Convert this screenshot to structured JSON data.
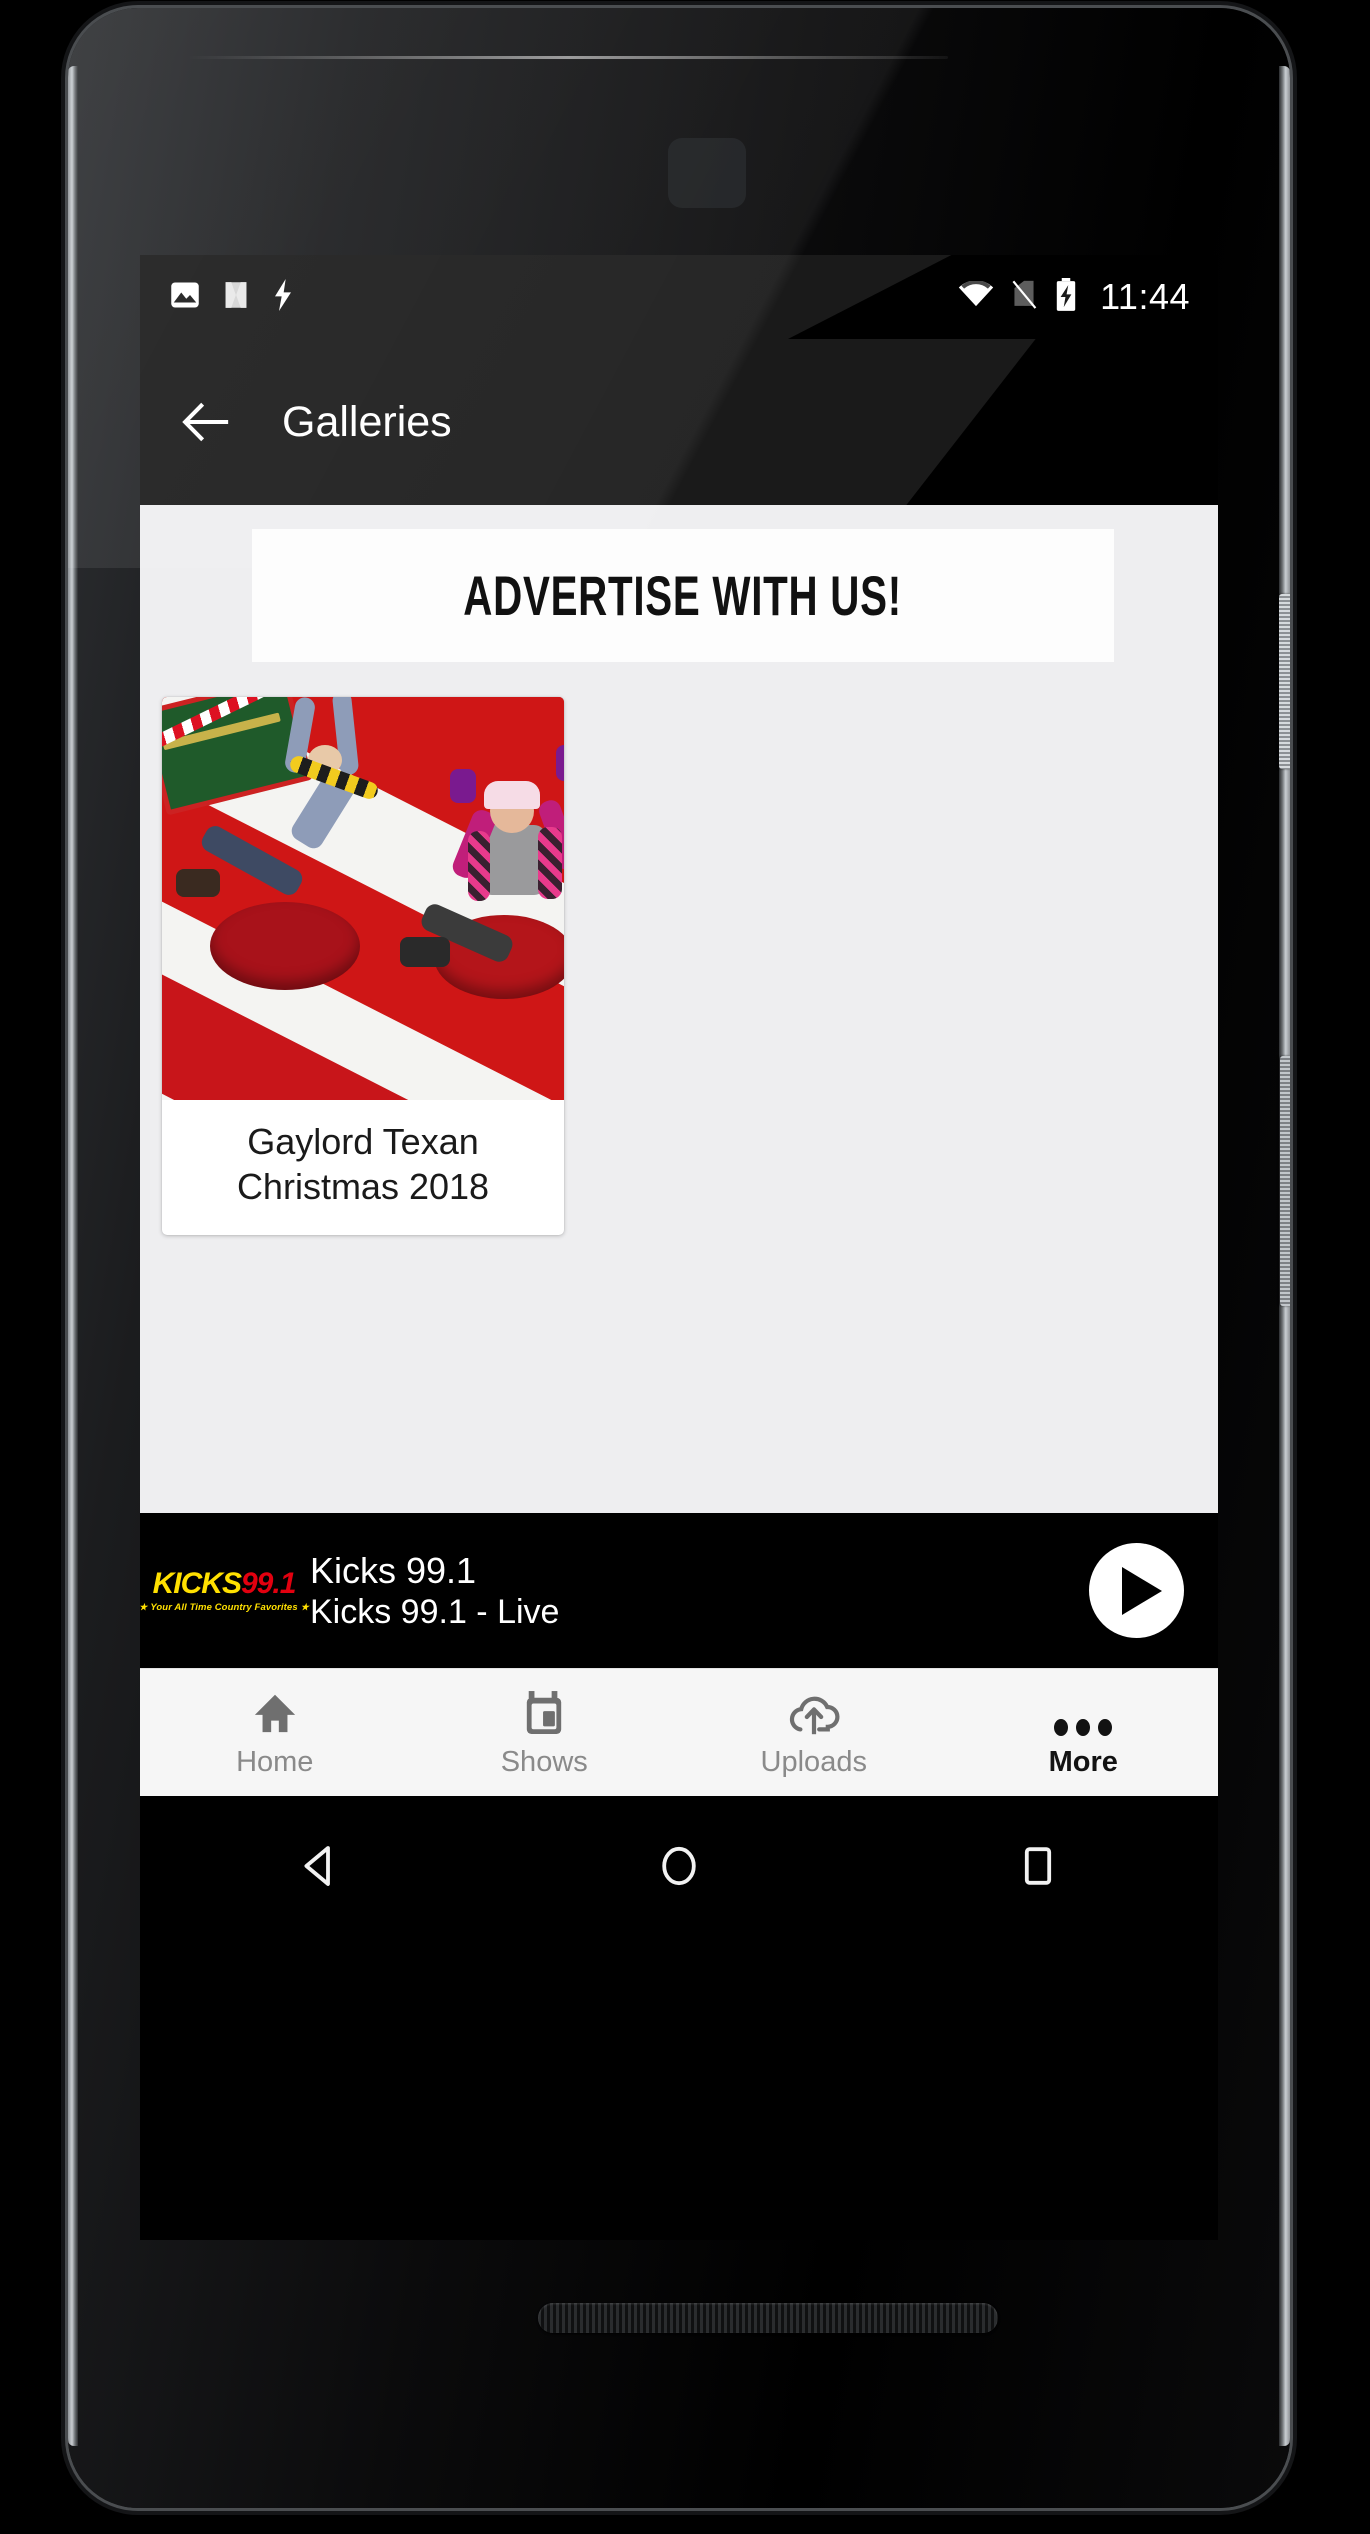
{
  "status_bar": {
    "time": "11:44",
    "left_icons": [
      {
        "name": "photo-icon",
        "glyph": "image"
      },
      {
        "name": "android-nougat-icon",
        "glyph": "N"
      },
      {
        "name": "lightning-bolt-icon",
        "glyph": "bolt"
      }
    ],
    "right_icons": [
      {
        "name": "wifi-icon",
        "glyph": "wifi-full"
      },
      {
        "name": "no-sim-icon",
        "glyph": "signal-off"
      },
      {
        "name": "battery-charging-icon",
        "glyph": "battery-bolt"
      }
    ]
  },
  "app_bar": {
    "title": "Galleries",
    "back_icon": "arrow-left-icon"
  },
  "ad": {
    "text": "ADVERTISE WITH US!"
  },
  "galleries": [
    {
      "title_line1": "Gaylord Texan",
      "title_line2": "Christmas 2018",
      "thumbnail_alt": "two children sliding down a red and white snow tubing hill"
    }
  ],
  "player": {
    "title": "Kicks 99.1",
    "subtitle": "Kicks 99.1 - Live",
    "play_icon": "play-icon",
    "logo": {
      "word_main": "KICKS",
      "word_number": "99.1",
      "tagline": "Your All Time Country Favorites",
      "color_main": "#ffe000",
      "color_number": "#e2000f"
    }
  },
  "bottom_nav": {
    "items": [
      {
        "label": "Home",
        "icon": "home-icon",
        "active": false
      },
      {
        "label": "Shows",
        "icon": "radio-icon",
        "active": false
      },
      {
        "label": "Uploads",
        "icon": "cloud-upload-icon",
        "active": false
      },
      {
        "label": "More",
        "icon": "more-dots-icon",
        "active": true
      }
    ]
  },
  "android_nav": {
    "back": "triangle-back-icon",
    "home": "circle-home-icon",
    "recents": "square-recents-icon"
  },
  "colors": {
    "screen_background": "#eeeef0",
    "app_bar": "#1a1a1a",
    "player_bar": "#000000",
    "nav_bar": "#f6f6f6",
    "accent_yellow": "#ffe000",
    "accent_red": "#e2000f"
  }
}
